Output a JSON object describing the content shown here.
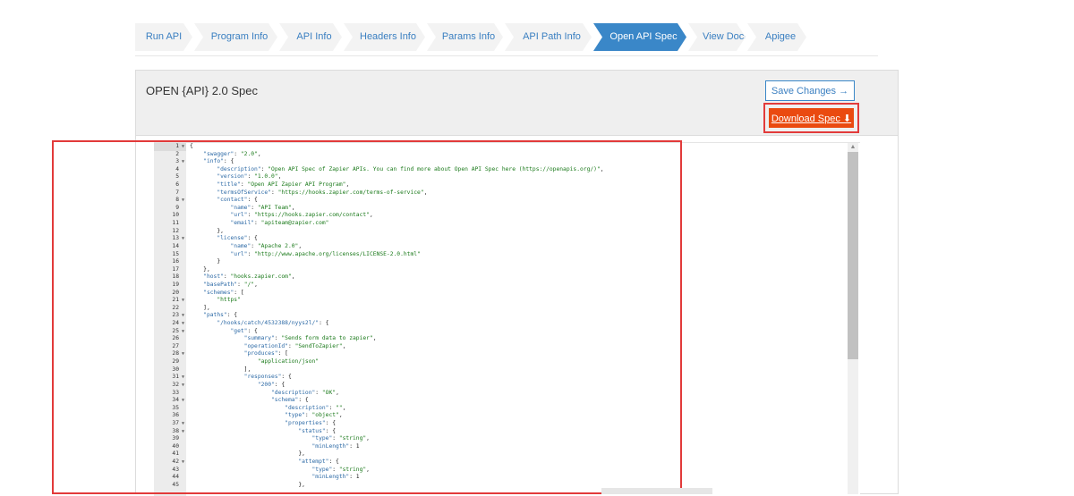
{
  "wizard": {
    "steps": [
      "Run API",
      "Program Info",
      "API Info",
      "Headers Info",
      "Params Info",
      "API Path Info",
      "Open API Spec",
      "View Docs",
      "Apigee"
    ],
    "active_index": 6
  },
  "panel": {
    "title": "OPEN {API} 2.0 Spec",
    "save_label": "Save Changes →",
    "download_label": "Download Spec  ⬇"
  },
  "editor": {
    "line_numbers": [
      "1",
      "2",
      "3",
      "4",
      "5",
      "6",
      "7",
      "8",
      "9",
      "10",
      "11",
      "12",
      "13",
      "14",
      "15",
      "16",
      "17",
      "18",
      "19",
      "20",
      "21",
      "22",
      "23",
      "24",
      "25",
      "26",
      "27",
      "28",
      "29",
      "30",
      "31",
      "32",
      "33",
      "34",
      "35",
      "36",
      "37",
      "38",
      "39",
      "40",
      "41",
      "42",
      "43",
      "44",
      "45"
    ],
    "fold_lines": [
      1,
      3,
      8,
      13,
      21,
      23,
      24,
      25,
      28,
      31,
      32,
      34,
      37,
      38,
      42
    ],
    "lines": [
      "{",
      "    \"swagger\": \"2.0\",",
      "    \"info\": {",
      "        \"description\": \"Open API Spec of Zapier APIs. You can find more about Open API Spec here (https://openapis.org/)\",",
      "        \"version\": \"1.0.0\",",
      "        \"title\": \"Open API Zapier API Program\",",
      "        \"termsOfService\": \"https://hooks.zapier.com/terms-of-service\",",
      "        \"contact\": {",
      "            \"name\": \"API Team\",",
      "            \"url\": \"https://hooks.zapier.com/contact\",",
      "            \"email\": \"apiteam@zapier.com\"",
      "        },",
      "        \"license\": {",
      "            \"name\": \"Apache 2.0\",",
      "            \"url\": \"http://www.apache.org/licenses/LICENSE-2.0.html\"",
      "        }",
      "    },",
      "    \"host\": \"hooks.zapier.com\",",
      "    \"basePath\": \"/\",",
      "    \"schemes\": [",
      "        \"https\"",
      "    ],",
      "    \"paths\": {",
      "        \"/hooks/catch/4532388/nyys2l/\": {",
      "            \"get\": {",
      "                \"summary\": \"Sends form data to zapier\",",
      "                \"operationId\": \"SendToZapier\",",
      "                \"produces\": [",
      "                    \"application/json\"",
      "                ],",
      "                \"responses\": {",
      "                    \"200\": {",
      "                        \"description\": \"OK\",",
      "                        \"schema\": {",
      "                            \"description\": \"\",",
      "                            \"type\": \"object\",",
      "                            \"properties\": {",
      "                                \"status\": {",
      "                                    \"type\": \"string\",",
      "                                    \"minLength\": 1",
      "                                },",
      "                                \"attempt\": {",
      "                                    \"type\": \"string\",",
      "                                    \"minLength\": 1",
      "                                },"
    ]
  },
  "colors": {
    "accent": "#3a87c8",
    "download_bg": "#ea4a10",
    "highlight": "#e23a3a",
    "key": "#2d6aa6",
    "string": "#1b7a1b"
  }
}
